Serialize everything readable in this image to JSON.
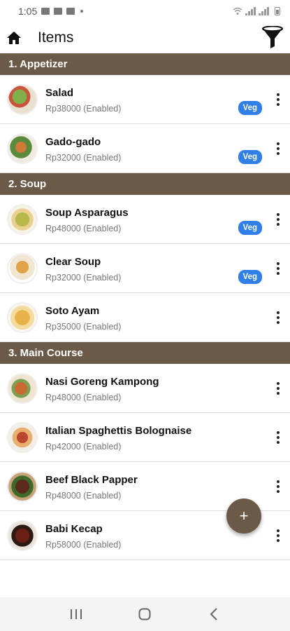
{
  "status": {
    "time": "1:05"
  },
  "appbar": {
    "title": "Items",
    "home_icon": "home-icon",
    "filter_icon": "filter-icon"
  },
  "colors": {
    "section_bg": "#6b5a48",
    "veg_badge": "#2f7fe6",
    "fab": "#6b5a48"
  },
  "sections": [
    {
      "title": "1. Appetizer",
      "items": [
        {
          "name": "Salad",
          "price": "Rp38000 (Enabled)",
          "veg": "Veg"
        },
        {
          "name": "Gado-gado",
          "price": "Rp32000 (Enabled)",
          "veg": "Veg"
        }
      ]
    },
    {
      "title": "2. Soup",
      "items": [
        {
          "name": "Soup Asparagus",
          "price": "Rp48000 (Enabled)",
          "veg": "Veg"
        },
        {
          "name": "Clear Soup",
          "price": "Rp32000 (Enabled)",
          "veg": "Veg"
        },
        {
          "name": "Soto Ayam",
          "price": "Rp35000 (Enabled)"
        }
      ]
    },
    {
      "title": "3. Main Course",
      "items": [
        {
          "name": "Nasi Goreng Kampong",
          "price": "Rp48000 (Enabled)"
        },
        {
          "name": "Italian Spaghettis Bolognaise",
          "price": "Rp42000 (Enabled)"
        },
        {
          "name": "Beef Black Papper",
          "price": "Rp48000 (Enabled)"
        },
        {
          "name": "Babi Kecap",
          "price": "Rp58000 (Enabled)"
        }
      ]
    }
  ],
  "fab": {
    "label": "+"
  }
}
